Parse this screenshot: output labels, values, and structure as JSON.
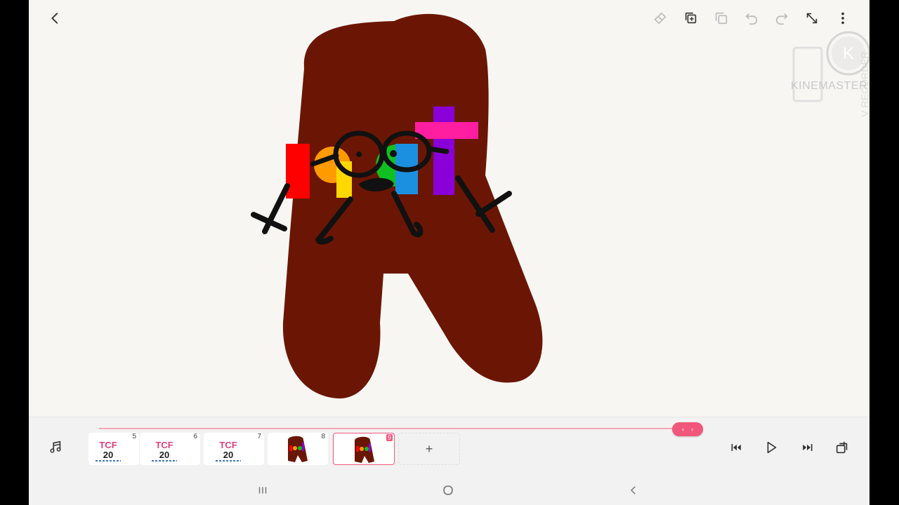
{
  "toolbar": {
    "back_icon": "chevron-left-icon",
    "icons": [
      "eraser-icon",
      "duplicate-layer-icon",
      "copy-icon",
      "undo-icon",
      "redo-icon",
      "expand-icon",
      "more-vert-icon"
    ]
  },
  "watermark": {
    "text": "KINEMASTER",
    "letter": "K",
    "side_text": "V RECORDER"
  },
  "timeline": {
    "music_icon": "music-note-icon",
    "frames": [
      {
        "number": "5",
        "thumb_text": "TCF",
        "thumb_sub": "20",
        "kind": "text"
      },
      {
        "number": "6",
        "thumb_text": "TCF",
        "thumb_sub": "20",
        "kind": "text"
      },
      {
        "number": "7",
        "thumb_text": "TCF",
        "thumb_sub": "20",
        "kind": "text"
      },
      {
        "number": "8",
        "thumb_text": "",
        "thumb_sub": "",
        "kind": "character"
      },
      {
        "number": "9",
        "thumb_text": "",
        "thumb_sub": "",
        "kind": "character",
        "active": true
      }
    ],
    "add_label": "+",
    "progress": 0.95,
    "handle_left": "‹",
    "handle_right": "›",
    "playback_icons": [
      "skip-to-start-icon",
      "play-icon",
      "skip-to-end-icon",
      "layers-copy-icon"
    ]
  },
  "navbar": {
    "icons": [
      "recent-apps-icon",
      "home-icon",
      "back-icon"
    ]
  },
  "colors": {
    "accent": "#f1577a",
    "character_brown": "#6b1604",
    "red": "#ff0000",
    "orange": "#ff9a00",
    "yellow": "#ffd800",
    "green": "#10c020",
    "blue": "#1c90e0",
    "purple": "#8a00d8",
    "pink": "#ff1ea0"
  }
}
